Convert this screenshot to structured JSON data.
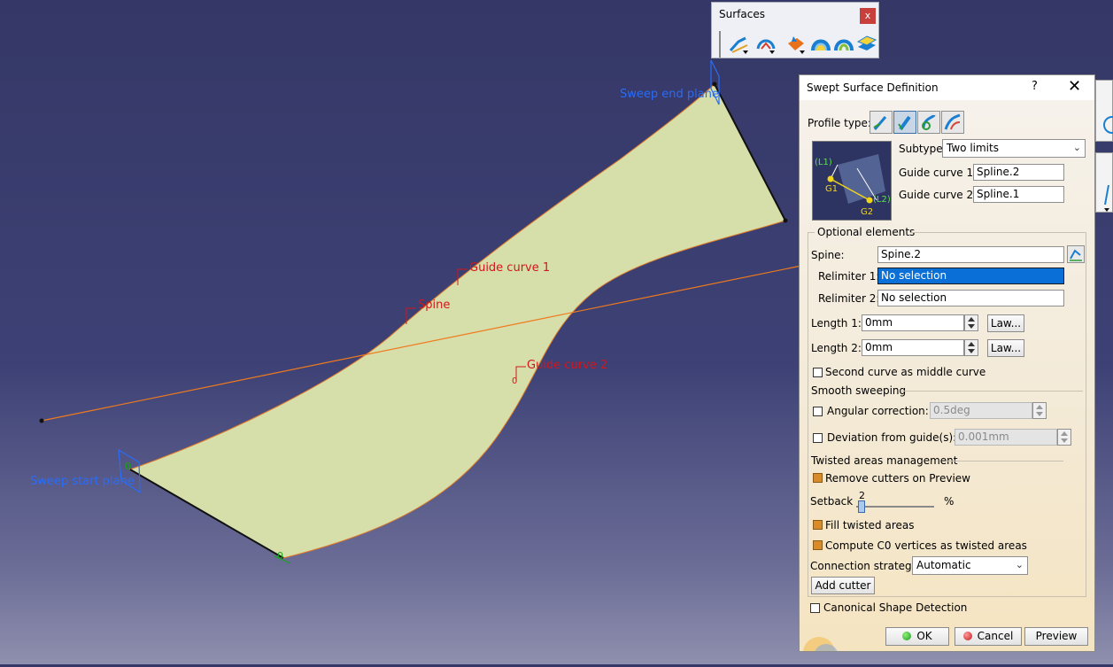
{
  "viewport": {
    "labels": {
      "sweep_end_plane": "Sweep end plane",
      "sweep_start_plane": "Sweep start plane",
      "guide_curve_1": "Guide curve 1",
      "guide_curve_2": "Guide curve 2",
      "spine": "Spine"
    },
    "colors": {
      "surface": "#d6deaa",
      "spine_line": "#f07a1e",
      "label_red": "#d4161c",
      "label_blue": "#2a6cf5"
    }
  },
  "toolbar": {
    "title": "Surfaces",
    "close": "x",
    "icons": [
      "sweep-icon",
      "fill-icon",
      "extrude-icon",
      "loft-icon",
      "blend-icon",
      "offset-icon"
    ]
  },
  "dialog": {
    "title": "Swept Surface Definition",
    "help": "?",
    "close": "✕",
    "profile_type_label": "Profile type:",
    "profile_types": [
      "explicit-profile-icon",
      "linear-profile-icon",
      "circle-profile-icon",
      "conic-profile-icon"
    ],
    "preview_image": {
      "l1": "(L1)",
      "l2": "(L2)",
      "g1": "G1",
      "g2": "G2"
    },
    "subtype": {
      "label": "Subtype:",
      "value": "Two limits"
    },
    "guide_curve_1": {
      "label": "Guide curve 1:",
      "value": "Spline.2"
    },
    "guide_curve_2": {
      "label": "Guide curve 2:",
      "value": "Spline.1"
    },
    "optional_elements": {
      "title": "Optional elements",
      "spine": {
        "label": "Spine:",
        "value": "Spine.2"
      },
      "relimiter_1": {
        "label": "Relimiter 1:",
        "value": "No selection"
      },
      "relimiter_2": {
        "label": "Relimiter 2:",
        "value": "No selection"
      },
      "length_1": {
        "label": "Length 1:",
        "value": "0mm",
        "law": "Law..."
      },
      "length_2": {
        "label": "Length 2:",
        "value": "0mm",
        "law": "Law..."
      },
      "second_curve_middle": {
        "label": "Second curve as middle curve",
        "checked": false
      }
    },
    "smooth_sweeping": {
      "title": "Smooth sweeping",
      "angular_correction": {
        "label": "Angular correction:",
        "value": "0.5deg",
        "checked": false
      },
      "deviation": {
        "label": "Deviation from guide(s):",
        "value": "0.001mm",
        "checked": false
      }
    },
    "twisted_areas": {
      "title": "Twisted areas management",
      "remove_cutters": {
        "label": "Remove cutters on Preview",
        "checked": true
      },
      "setback": {
        "label": "Setback",
        "value": "2",
        "unit": "%",
        "fraction": 0.02
      },
      "fill_twisted": {
        "label": "Fill twisted areas",
        "checked": true
      },
      "compute_c0": {
        "label": "Compute C0 vertices as twisted areas",
        "checked": true
      },
      "connection_strategy": {
        "label": "Connection strategy:",
        "value": "Automatic"
      },
      "add_cutter": "Add cutter"
    },
    "canonical_shape": {
      "label": "Canonical Shape Detection",
      "checked": false
    },
    "buttons": {
      "ok": "OK",
      "cancel": "Cancel",
      "preview": "Preview"
    }
  }
}
